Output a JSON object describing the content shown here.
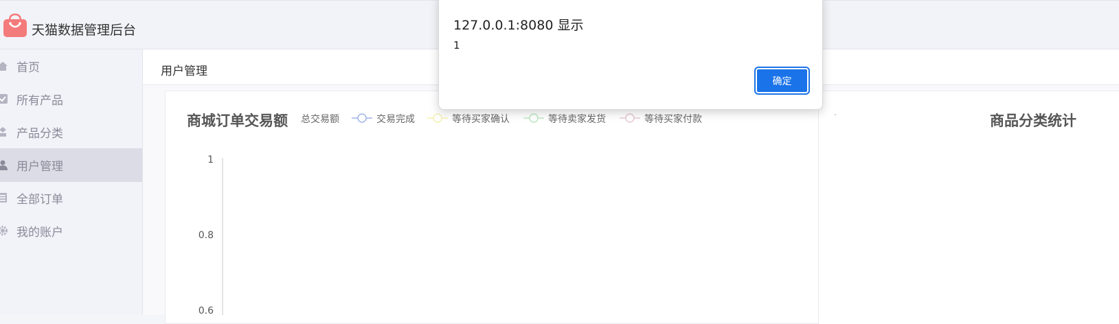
{
  "app": {
    "title": "天猫数据管理后台"
  },
  "sidebar": {
    "items": [
      {
        "label": "首页",
        "icon": "home-icon",
        "active": false
      },
      {
        "label": "所有产品",
        "icon": "checkbox-icon",
        "active": false
      },
      {
        "label": "产品分类",
        "icon": "category-icon",
        "active": false
      },
      {
        "label": "用户管理",
        "icon": "user-icon",
        "active": true
      },
      {
        "label": "全部订单",
        "icon": "order-icon",
        "active": false
      },
      {
        "label": "我的账户",
        "icon": "gear-icon",
        "active": false
      }
    ]
  },
  "breadcrumb": {
    "current": "用户管理"
  },
  "chart_data": {
    "type": "line",
    "title": "商城订单交易额",
    "legend_label": "总交易额",
    "series": [
      {
        "name": "交易完成",
        "color": "#9fb4e8",
        "values": []
      },
      {
        "name": "等待买家确认",
        "color": "#f5efb0",
        "values": []
      },
      {
        "name": "等待卖家发货",
        "color": "#bde8c0",
        "values": []
      },
      {
        "name": "等待买家付款",
        "color": "#e8c8d6",
        "values": []
      }
    ],
    "yticks": [
      "1",
      "0.8",
      "0.6"
    ],
    "ylim": [
      0,
      1
    ]
  },
  "right_panel": {
    "title": "商品分类统计"
  },
  "dialog": {
    "title": "127.0.0.1:8080 显示",
    "message": "1",
    "ok_label": "确定"
  },
  "colors": {
    "accent": "#1a73e8",
    "logo": "#f47b7b",
    "sidebar_active": "#dcdce6"
  }
}
